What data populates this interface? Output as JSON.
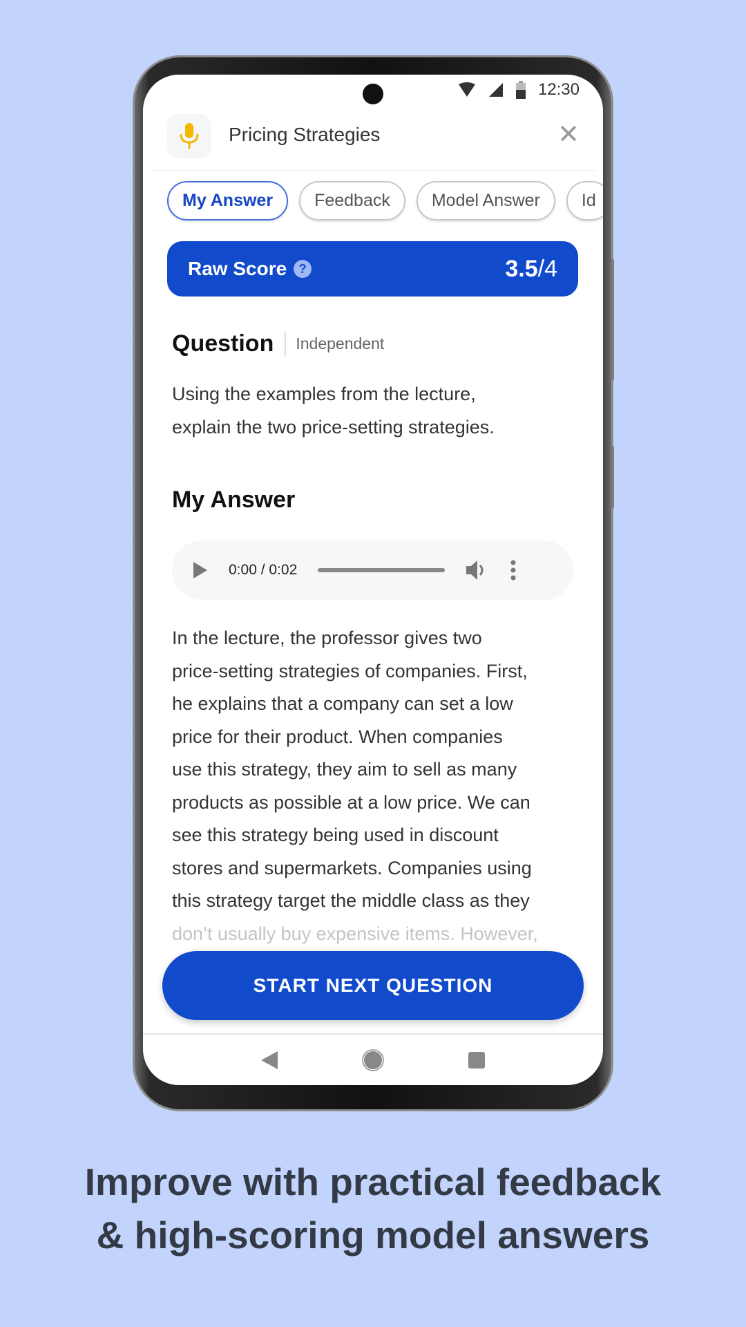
{
  "status": {
    "time": "12:30",
    "icons": [
      "wifi-icon",
      "signal-icon",
      "battery-icon"
    ]
  },
  "header": {
    "title": "Pricing Strategies",
    "app_icon": "microphone-icon",
    "close_icon": "close-icon"
  },
  "tabs": [
    {
      "label": "My Answer",
      "active": true
    },
    {
      "label": "Feedback"
    },
    {
      "label": "Model Answer"
    },
    {
      "label": "Id"
    }
  ],
  "score": {
    "label": "Raw Score",
    "value": "3.5",
    "max": "/4"
  },
  "question": {
    "heading": "Question",
    "tag": "Independent",
    "lines": [
      "Using the examples from the lecture,",
      "explain the two price-setting strategies."
    ]
  },
  "answer": {
    "heading": "My Answer",
    "audio": {
      "time": "0:00 / 0:02",
      "progress": 0
    },
    "lines": [
      "In the lecture, the professor gives two",
      "price-setting strategies of companies. First,",
      "he explains that a company can set a low",
      "price for their product. When companies",
      "use this strategy, they aim to sell as many",
      "products as possible at a low price. We can",
      "see this strategy being used in discount",
      "stores and supermarkets. Companies using",
      "this strategy target the middle class as they",
      "don’t usually buy expensive items. However,"
    ]
  },
  "cta": "START NEXT QUESTION",
  "caption": [
    "Improve with practical feedback",
    "& high-scoring model answers"
  ],
  "colors": {
    "accent": "#114bcb",
    "background": "#c3d4fc",
    "mic": "#f5b800"
  }
}
